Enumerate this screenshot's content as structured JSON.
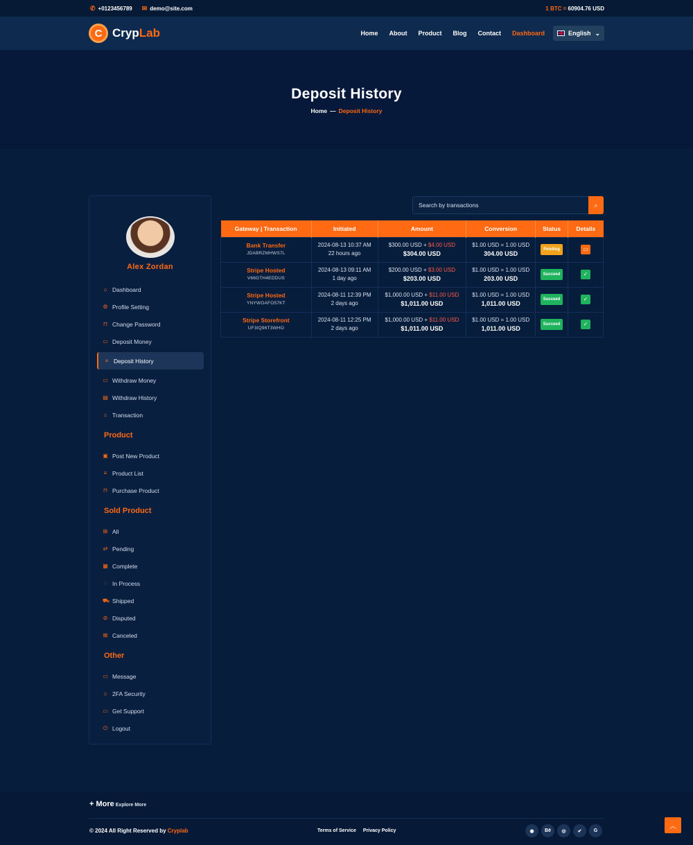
{
  "topbar": {
    "phone": "+0123456789",
    "email": "demo@site.com",
    "btc_label": "1 BTC =",
    "btc_value": "60904.76 USD"
  },
  "nav": {
    "logo_mark": "C",
    "logo_a": "Cryp",
    "logo_b": "Lab",
    "items": [
      "Home",
      "About",
      "Product",
      "Blog",
      "Contact",
      "Dashboard"
    ],
    "language": "English"
  },
  "hero": {
    "title": "Deposit History",
    "crumb_home": "Home",
    "crumb_sep": "—",
    "crumb_current": "Deposit History"
  },
  "sidebar": {
    "user_name": "Alex Zordan",
    "items": [
      "Dashboard",
      "Profile Setting",
      "Change Password",
      "Deposit Money",
      "Deposit History",
      "Withdraw Money",
      "Withdraw History",
      "Transaction"
    ],
    "section_product": "Product",
    "product_items": [
      "Post New Product",
      "Product List",
      "Purchase Product"
    ],
    "section_sold": "Sold Product",
    "sold_items": [
      "All",
      "Pending",
      "Complete",
      "In Process",
      "Shipped",
      "Disputed",
      "Canceled"
    ],
    "section_other": "Other",
    "other_items": [
      "Message",
      "2FA Security",
      "Get Support",
      "Logout"
    ]
  },
  "search": {
    "placeholder": "Search by transactions"
  },
  "table": {
    "headers": [
      "Gateway | Transaction",
      "Initiated",
      "Amount",
      "Conversion",
      "Status",
      "Details"
    ],
    "rows": [
      {
        "gateway": "Bank Transfer",
        "trx": "JDABRZMHWS7L",
        "date": "2024-08-13 10:37 AM",
        "ago": "22 hours ago",
        "amount": "$300.00 USD",
        "plus": " + ",
        "fee": "$4.00 USD",
        "total": "$304.00 USD",
        "rate": "$1.00 USD = 1.00 USD",
        "converted": "304.00 USD",
        "status": "Pending"
      },
      {
        "gateway": "Stripe Hosted",
        "trx": "V66GTH4EDDUS",
        "date": "2024-08-13 09:11 AM",
        "ago": "1 day ago",
        "amount": "$200.00 USD",
        "plus": " + ",
        "fee": "$3.00 USD",
        "total": "$203.00 USD",
        "rate": "$1.00 USD = 1.00 USD",
        "converted": "203.00 USD",
        "status": "Succeed"
      },
      {
        "gateway": "Stripe Hosted",
        "trx": "YNYWOAFO57KT",
        "date": "2024-08-11 12:39 PM",
        "ago": "2 days ago",
        "amount": "$1,000.00 USD",
        "plus": " + ",
        "fee": "$11.00 USD",
        "total": "$1,011.00 USD",
        "rate": "$1.00 USD = 1.00 USD",
        "converted": "1,011.00 USD",
        "status": "Succeed"
      },
      {
        "gateway": "Stripe Storefront",
        "trx": "UF3IQ96T3WHO",
        "date": "2024-08-11 12:25 PM",
        "ago": "2 days ago",
        "amount": "$1,000.00 USD",
        "plus": " + ",
        "fee": "$11.00 USD",
        "total": "$1,011.00 USD",
        "rate": "$1.00 USD = 1.00 USD",
        "converted": "1,011.00 USD",
        "status": "Succeed"
      }
    ]
  },
  "footer": {
    "more": "+ More",
    "explore": "Explore More",
    "copy": "© 2024 All Right Reserved by ",
    "brand": "Cryplab",
    "terms": "Terms of Service",
    "privacy": "Privacy Policy",
    "social_glyphs": [
      "◉",
      "Bē",
      "◎",
      "✔",
      "G"
    ]
  },
  "colors": {
    "accent": "#ff6a13",
    "bg": "#071d3c",
    "success": "#1fb35e",
    "pending": "#f3a21b",
    "fee": "#ff5a4a"
  }
}
